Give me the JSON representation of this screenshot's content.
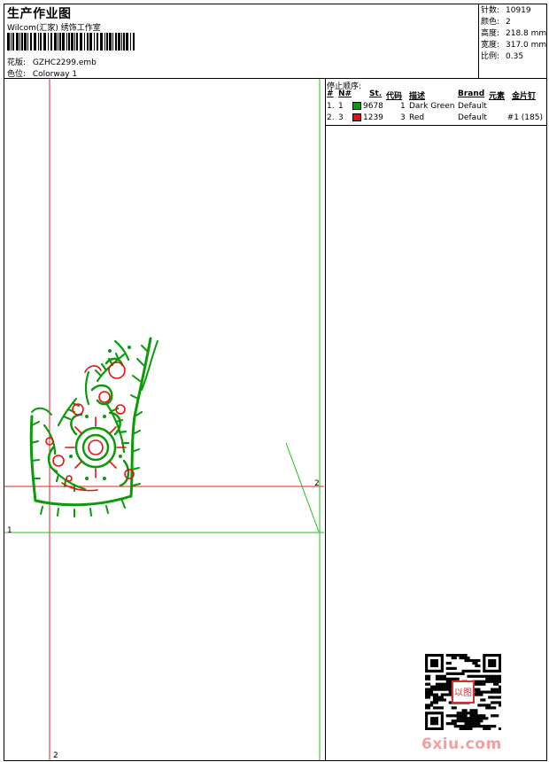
{
  "header": {
    "title": "生产作业图",
    "subtitle": "Wilcom(汇家) 绣饰工作室",
    "design_label": "花版:",
    "design_value": "GZHC2299.emb",
    "colorway_label": "色位:",
    "colorway_value": "Colorway 1"
  },
  "stats": [
    {
      "label": "针数:",
      "value": "10919"
    },
    {
      "label": "颜色:",
      "value": "2"
    },
    {
      "label": "高度:",
      "value": "218.8 mm"
    },
    {
      "label": "宽度:",
      "value": "317.0 mm"
    },
    {
      "label": "比例:",
      "value": "0.35"
    }
  ],
  "stop_sequence": {
    "title": "停止顺序:",
    "headers": {
      "num": "#",
      "n": "N#",
      "st": "St.",
      "code": "代码",
      "desc": "描述",
      "brand": "Brand",
      "elem": "元素",
      "sequin": "金片钉"
    },
    "rows": [
      {
        "num": "1.",
        "n": "1",
        "color": "#0a9a0a",
        "st": "9678",
        "code": "1",
        "desc": "Dark Green",
        "brand": "Default",
        "sequin": ""
      },
      {
        "num": "2.",
        "n": "3",
        "color": "#e81010",
        "st": "1239",
        "code": "3",
        "desc": "Red",
        "brand": "Default",
        "sequin": "#1 (185)"
      }
    ]
  },
  "guides": {
    "label_1": "1",
    "label_2_right": "2",
    "label_2_bottom": "2"
  },
  "watermark": "6xiu.com",
  "qr_seal": "以图"
}
